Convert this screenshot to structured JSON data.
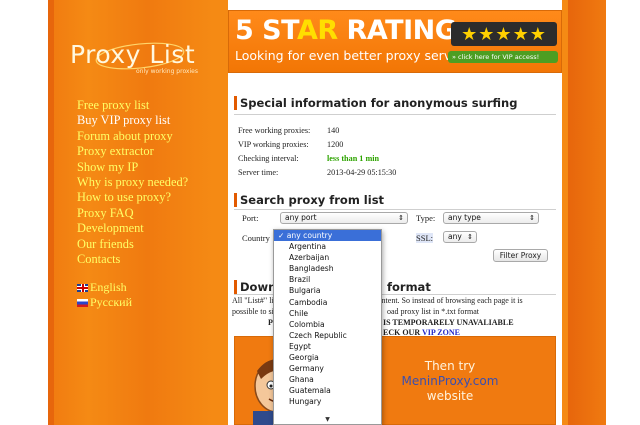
{
  "logo": {
    "text": "Proxy List",
    "tagline": "only working proxies"
  },
  "nav": {
    "items": [
      "Free proxy list",
      "Buy VIP proxy list",
      "Forum about proxy",
      "Proxy extractor",
      "Show my IP",
      "Why is proxy needed?",
      "How to use proxy?",
      "Proxy FAQ",
      "Development",
      "Our friends",
      "Contacts"
    ],
    "active_index": 1
  },
  "languages": [
    "English",
    "Русский"
  ],
  "banner": {
    "title_1": "5 ST",
    "title_2": "AR",
    "title_3": " RATING",
    "stars": "★★★★★",
    "subtitle": "Looking for even better proxy servers?",
    "vip_button": "» click here for VIP access!"
  },
  "info_section": {
    "heading": "Special information for anonymous surfing",
    "rows": [
      {
        "label": "Free working proxies:",
        "value": "140"
      },
      {
        "label": "VIP working proxies:",
        "value": "1200"
      },
      {
        "label": "Checking interval:",
        "value": "less than 1 min"
      },
      {
        "label": "Server time:",
        "value": "2013-04-29 05:15:30"
      }
    ]
  },
  "search_section": {
    "heading": "Search proxy from list",
    "port_label": "Port:",
    "port_value": "any port",
    "type_label": "Type:",
    "type_value": "any type",
    "country_label": "Country",
    "ssl_label": "SSL:",
    "ssl_value": "any",
    "filter_button": "Filter Proxy"
  },
  "download_section": {
    "heading_left": "Downlo",
    "heading_right": "format",
    "text_1_left": "All \"List#\" li",
    "text_1_right": "content. So instead of browsing each page it is",
    "text_2_left": "possible to si",
    "text_2_right": "oad proxy list in *.txt format",
    "bold_1_left": "PR",
    "bold_1_right": "IS TEMPORARELY UNAVALIABLE",
    "bold_2_right": "ECK OUR ",
    "vip_zone": "VIP ZONE"
  },
  "ad": {
    "line_1": "Then try",
    "line_2": "MeninProxy.com",
    "line_3": "website"
  },
  "country_dropdown": {
    "selected": "any country",
    "options": [
      "Argentina",
      "Azerbaijan",
      "Bangladesh",
      "Brazil",
      "Bulgaria",
      "Cambodia",
      "Chile",
      "Colombia",
      "Czech Republic",
      "Egypt",
      "Georgia",
      "Germany",
      "Ghana",
      "Guatemala",
      "Hungary"
    ]
  },
  "colors": {
    "orange": "#f07a10",
    "link_yellow": "#ffff66",
    "green_value": "#2ea400",
    "vip_link": "#2226c8"
  }
}
